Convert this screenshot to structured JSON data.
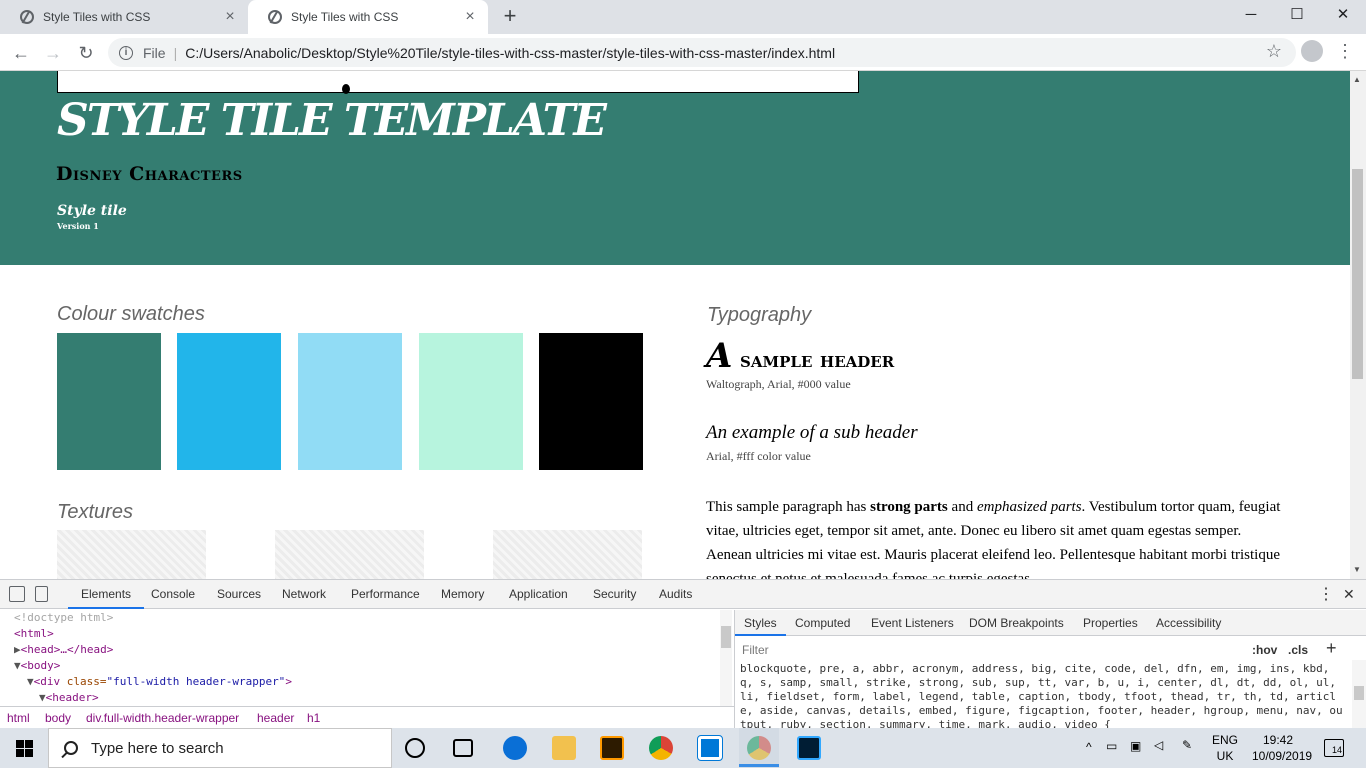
{
  "browser": {
    "tabs": [
      {
        "title": "Style Tiles with CSS",
        "active": false
      },
      {
        "title": "Style Tiles with CSS",
        "active": true
      }
    ],
    "new_tab_symbol": "+",
    "window_controls": {
      "minimize": "─",
      "maximize": "☐",
      "close": "✕"
    },
    "address": {
      "scheme_label": "File",
      "url": "C:/Users/Anabolic/Desktop/Style%20Tile/style-tiles-with-css-master/style-tiles-with-css-master/index.html"
    }
  },
  "page": {
    "colors": {
      "header": "#347d71"
    },
    "title": "STYLE TILE TEMPLATE",
    "subtitle": "Disney Characters",
    "tile_label": "Style tile",
    "version": "Version 1",
    "colour_heading": "Colour swatches",
    "swatches": [
      "#347d71",
      "#22b5ea",
      "#91dcf5",
      "#b7f4de",
      "#000000"
    ],
    "textures_heading": "Textures",
    "typography_heading": "Typography",
    "sample_header_initial": "A",
    "sample_header_rest": " sample header",
    "sample_header_note": "Waltograph, Arial, #000 value",
    "subheader_example": "An example of a sub header",
    "subheader_note": "Arial, #fff color value",
    "paragraph": {
      "lead": "This sample paragraph has ",
      "strong": "strong parts",
      "mid": " and ",
      "em": "emphasized parts",
      "tail": ". Vestibulum tortor quam, feugiat vitae, ultricies eget, tempor sit amet, ante. Donec eu libero sit amet quam egestas semper. Aenean ultricies mi vitae est. Mauris placerat eleifend leo. Pellentesque habitant morbi tristique senectus et netus et malesuada fames ac turpis egestas."
    }
  },
  "devtools": {
    "tabs": [
      "Elements",
      "Console",
      "Sources",
      "Network",
      "Performance",
      "Memory",
      "Application",
      "Security",
      "Audits"
    ],
    "dom": {
      "doctype": "<!doctype html>",
      "html": "<html>",
      "head": "<head>…</head>",
      "body": "<body>",
      "div_tag": "<div ",
      "div_attr": "class=",
      "div_val": "\"full-width header-wrapper\"",
      "div_close": ">",
      "header": "<header>"
    },
    "breadcrumbs": [
      "html",
      "body",
      "div.full-width.header-wrapper",
      "header",
      "h1"
    ],
    "styles_tabs": [
      "Styles",
      "Computed",
      "Event Listeners",
      "DOM Breakpoints",
      "Properties",
      "Accessibility"
    ],
    "filter_placeholder": "Filter",
    "hov": ":hov",
    "cls": ".cls",
    "plus": "+",
    "rule_text": "blockquote, pre, a, abbr, acronym, address, big, cite, code, del, dfn, em, img, ins, kbd, q, s, samp, small, strike, strong, sub, sup, tt, var, b, u, i, center, dl, dt, dd, ol, ul, li, fieldset, form, label, legend, table, caption, tbody, tfoot, thead, tr, th, td, article, aside, canvas, details, embed, figure, figcaption, footer, header, hgroup, menu, nav, output, ruby, section, summary, time, mark, audio, video {"
  },
  "taskbar": {
    "search_placeholder": "Type here to search",
    "language": "ENG",
    "region": "UK",
    "time": "19:42",
    "date": "10/09/2019",
    "notification_count": "14"
  }
}
